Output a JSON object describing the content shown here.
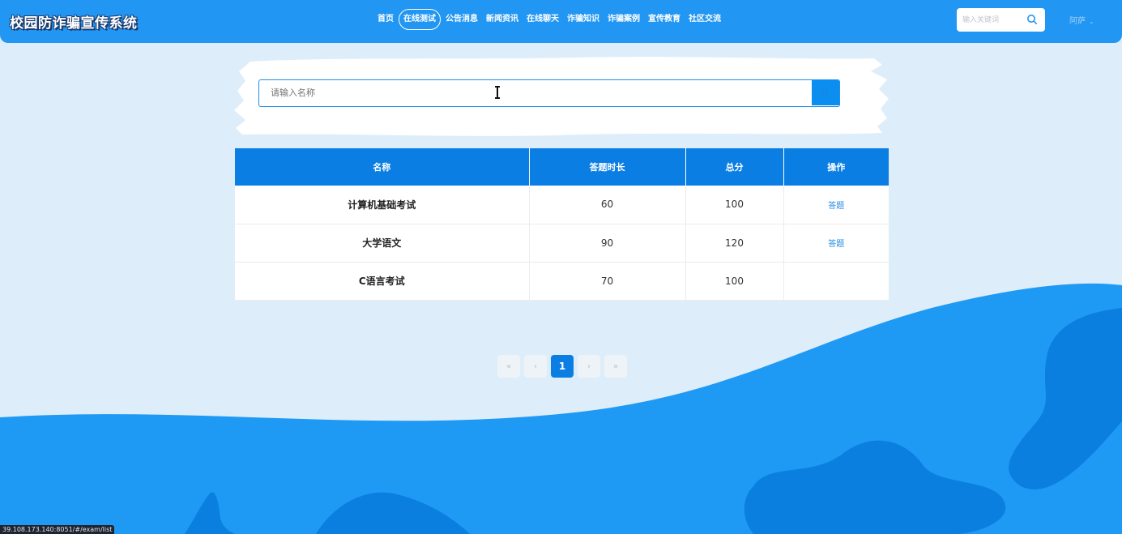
{
  "header": {
    "logo": "校园防诈骗宣传系统",
    "nav": [
      "首页",
      "在线测试",
      "公告消息",
      "新闻资讯",
      "在线聊天",
      "诈骗知识",
      "诈骗案例",
      "宣传教育",
      "社区交流"
    ],
    "active_nav": "在线测试",
    "search_placeholder": "输入关键词",
    "user_name": "阿萨",
    "user_caret": "⌄"
  },
  "search": {
    "placeholder": "请输入名称"
  },
  "table": {
    "headers": [
      "名称",
      "答题时长",
      "总分",
      "操作"
    ],
    "rows": [
      {
        "name": "计算机基础考试",
        "duration": "60",
        "score": "100",
        "action": "答题"
      },
      {
        "name": "大学语文",
        "duration": "90",
        "score": "120",
        "action": "答题"
      },
      {
        "name": "C语言考试",
        "duration": "70",
        "score": "100",
        "action": ""
      }
    ]
  },
  "pagination": {
    "first": "«",
    "prev": "‹",
    "current": "1",
    "next": "›",
    "last": "»"
  },
  "status_url": "39.108.173.140:8051/#/exam/list",
  "colors": {
    "header": "#2196f3",
    "accent": "#0a7ee3",
    "background": "#ddedf9",
    "wave": "#1e9af4",
    "wave_dark": "#0a7fe0"
  }
}
